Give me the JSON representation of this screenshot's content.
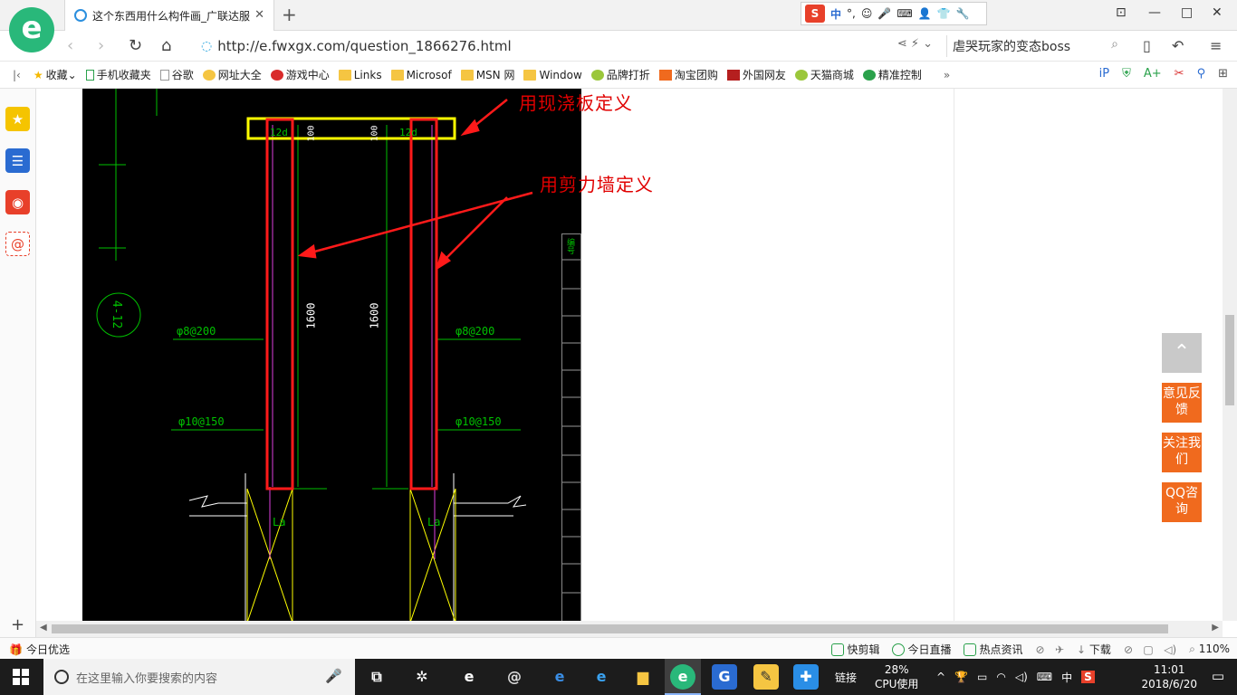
{
  "tab": {
    "title": "这个东西用什么构件画_广联达服",
    "close": "✕",
    "new": "+"
  },
  "ime": {
    "label": "中",
    "punct": "°,",
    "smile": "☺",
    "mic": "🎤",
    "kbd": "⌨",
    "person": "👤",
    "shirt": "👕",
    "wrench": "🔧"
  },
  "window": {
    "pin": "⊡",
    "min": "—",
    "max": "□",
    "close": "✕"
  },
  "address": {
    "url": "http://e.fwxgx.com/question_1866276.html",
    "search_query": "虐哭玩家的变态boss",
    "back": "‹",
    "forward": "›",
    "refresh": "↻",
    "home": "⌂"
  },
  "bookmarks": [
    "收藏",
    "手机收藏夹",
    "谷歌",
    "网址大全",
    "游戏中心",
    "Links",
    "Microsof",
    "MSN 网",
    "Window",
    "品牌打折",
    "淘宝团购",
    "外国网友",
    "天猫商城",
    "精准控制"
  ],
  "bookmarks_more": "»",
  "cad": {
    "annotation_slab": "用现浇板定义",
    "annotation_wall": "用剪力墙定义",
    "dim_12d_left": "12d",
    "dim_12d_right": "12d",
    "dim_100_a": "100",
    "dim_100_b": "100",
    "dim_1600_left": "1600",
    "dim_1600_right": "1600",
    "bubble": "4-12",
    "rebar_a_left": "φ8@200",
    "rebar_a_right": "φ8@200",
    "rebar_b_left": "φ10@150",
    "rebar_b_right": "φ10@150",
    "la_left": "La",
    "la_right": "La",
    "table_head": "编号"
  },
  "float_buttons": {
    "top": "⌃",
    "feedback": "意见反馈",
    "follow": "关注我们",
    "qq": "QQ咨询"
  },
  "status": {
    "left": "今日优选",
    "items": [
      "快剪辑",
      "今日直播",
      "热点资讯",
      "下载",
      "110%"
    ]
  },
  "taskbar": {
    "search_placeholder": "在这里输入你要搜索的内容",
    "link_label": "链接",
    "cpu_percent": "28%",
    "cpu_label": "CPU使用",
    "ime": "中",
    "time": "11:01",
    "date": "2018/6/20"
  },
  "colors": {
    "accent_orange": "#f06a1e",
    "cad_bg": "#000000",
    "cad_green": "#00c000",
    "cad_red": "#ff1a1a",
    "cad_yellow": "#ffff00"
  }
}
